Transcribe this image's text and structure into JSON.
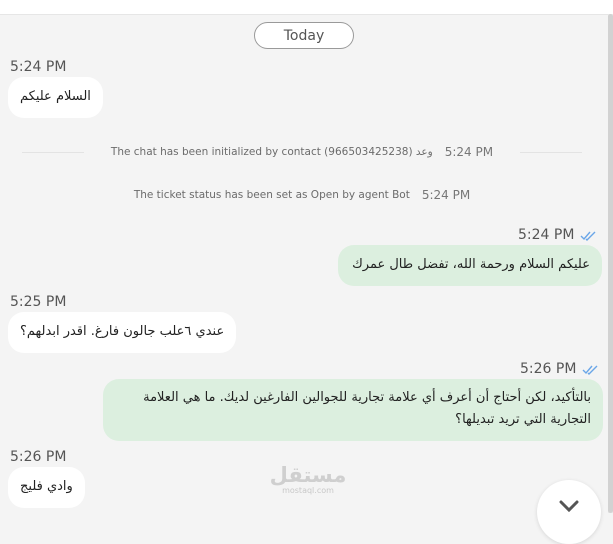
{
  "header": {
    "date_divider": "Today"
  },
  "messages": [
    {
      "direction": "incoming",
      "time": "5:24 PM",
      "text": "السلام عليكم"
    },
    {
      "direction": "system",
      "text": "The chat has been initialized by contact (966503425238) وعد",
      "time": "5:24 PM"
    },
    {
      "direction": "system",
      "text": "The ticket status has been set as Open by agent Bot",
      "time": "5:24 PM"
    },
    {
      "direction": "outgoing",
      "time": "5:24 PM",
      "text": "عليكم السلام ورحمة الله، تفضل طال عمرك",
      "status_icon": "double-check-icon"
    },
    {
      "direction": "incoming",
      "time": "5:25 PM",
      "text": "عندي ٦علب جالون فارغ. اقدر ابدلهم؟"
    },
    {
      "direction": "outgoing",
      "time": "5:26 PM",
      "text": "بالتأكيد، لكن أحتاج أن أعرف أي علامة تجارية للجوالين الفارغين لديك. ما هي العلامة التجارية التي تريد تبديلها؟",
      "status_icon": "double-check-icon"
    },
    {
      "direction": "incoming",
      "time": "5:26 PM",
      "text": "وادي فليج"
    }
  ],
  "watermark": {
    "text": "مستقل",
    "sub": "mostaql.com"
  },
  "controls": {
    "scroll_button_icon": "chevron-down-icon"
  },
  "colors": {
    "outgoing_bubble": "#dcefdf",
    "incoming_bubble": "#ffffff",
    "check_icon": "#6aa6e8",
    "background": "#f4f4f4"
  }
}
